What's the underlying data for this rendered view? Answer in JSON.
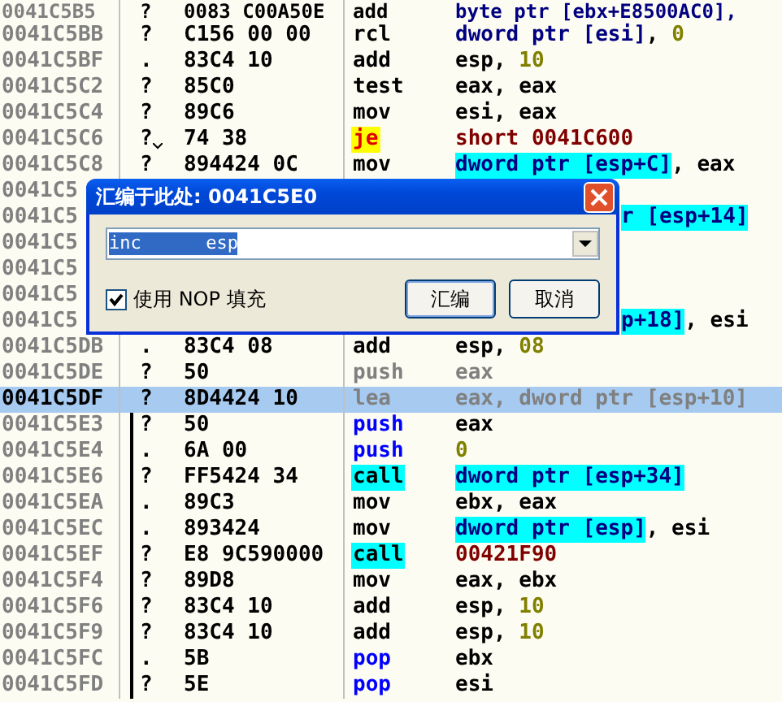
{
  "listing": [
    {
      "kind": "instruction",
      "address": "0041C5B5",
      "mark": "?",
      "hex": "0083 C00A50E",
      "mnemonic": {
        "text": "add",
        "kind": "plain"
      },
      "operand": [
        {
          "text": "byte ptr [ebx+E8500AC0],",
          "kind": "ptr"
        }
      ],
      "selected": false,
      "dimmed": false,
      "bracket": false,
      "jump_arrow": false
    },
    {
      "kind": "instruction",
      "address": "0041C5BB",
      "mark": "?",
      "hex": "C156 00 00",
      "mnemonic": {
        "text": "rcl",
        "kind": "plain"
      },
      "operand": [
        {
          "text": "dword ptr [esi]",
          "kind": "ptr"
        },
        {
          "text": ", ",
          "kind": "reg"
        },
        {
          "text": "0",
          "kind": "num"
        }
      ],
      "selected": false,
      "dimmed": false,
      "bracket": false,
      "jump_arrow": false
    },
    {
      "kind": "instruction",
      "address": "0041C5BF",
      "mark": ".",
      "hex": "83C4 10",
      "mnemonic": {
        "text": "add",
        "kind": "plain"
      },
      "operand": [
        {
          "text": "esp, ",
          "kind": "reg"
        },
        {
          "text": "10",
          "kind": "num"
        }
      ],
      "selected": false,
      "dimmed": false,
      "bracket": false,
      "jump_arrow": false
    },
    {
      "kind": "instruction",
      "address": "0041C5C2",
      "mark": "?",
      "hex": "85C0",
      "mnemonic": {
        "text": "test",
        "kind": "plain"
      },
      "operand": [
        {
          "text": "eax, eax",
          "kind": "reg"
        }
      ],
      "selected": false,
      "dimmed": false,
      "bracket": false,
      "jump_arrow": false
    },
    {
      "kind": "instruction",
      "address": "0041C5C4",
      "mark": "?",
      "hex": "89C6",
      "mnemonic": {
        "text": "mov",
        "kind": "plain"
      },
      "operand": [
        {
          "text": "esi, eax",
          "kind": "reg"
        }
      ],
      "selected": false,
      "dimmed": false,
      "bracket": false,
      "jump_arrow": false
    },
    {
      "kind": "instruction",
      "address": "0041C5C6",
      "mark": "?",
      "hex": "74 38",
      "mnemonic": {
        "text": "je",
        "kind": "jump"
      },
      "operand": [
        {
          "text": "short 0041C600",
          "kind": "addr"
        }
      ],
      "selected": false,
      "dimmed": false,
      "bracket": false,
      "jump_arrow": true
    },
    {
      "kind": "instruction",
      "address": "0041C5C8",
      "mark": "?",
      "hex": "894424 0C",
      "mnemonic": {
        "text": "mov",
        "kind": "plain"
      },
      "operand": [
        {
          "text": "dword ptr [esp+C]",
          "kind": "mem"
        },
        {
          "text": ", eax",
          "kind": "reg"
        }
      ],
      "selected": false,
      "dimmed": false,
      "bracket": false,
      "jump_arrow": false
    },
    {
      "kind": "covered",
      "address": "0041C5",
      "selected": false
    },
    {
      "kind": "covered",
      "address": "0041C5",
      "tail": [
        {
          "text": "r [esp+14]",
          "kind": "mem"
        }
      ],
      "selected": false
    },
    {
      "kind": "covered",
      "address": "0041C5",
      "selected": false
    },
    {
      "kind": "covered",
      "address": "0041C5",
      "selected": false
    },
    {
      "kind": "covered",
      "address": "0041C5",
      "selected": false
    },
    {
      "kind": "covered",
      "address": "0041C5",
      "tail": [
        {
          "text": "p+18]",
          "kind": "mem"
        },
        {
          "text": ", esi",
          "kind": "reg"
        }
      ],
      "selected": false
    },
    {
      "kind": "instruction",
      "address": "0041C5DB",
      "mark": ".",
      "hex": "83C4 08",
      "mnemonic": {
        "text": "add",
        "kind": "plain"
      },
      "operand": [
        {
          "text": "esp, ",
          "kind": "reg"
        },
        {
          "text": "08",
          "kind": "num"
        }
      ],
      "selected": false,
      "dimmed": false,
      "bracket": false,
      "jump_arrow": false
    },
    {
      "kind": "instruction",
      "address": "0041C5DE",
      "mark": "?",
      "hex": "50",
      "mnemonic": {
        "text": "push",
        "kind": "stack"
      },
      "operand": [
        {
          "text": "eax",
          "kind": "reg"
        }
      ],
      "selected": false,
      "dimmed": true,
      "bracket": false,
      "jump_arrow": false
    },
    {
      "kind": "instruction",
      "address": "0041C5DF",
      "mark": "?",
      "hex": "8D4424 10",
      "mnemonic": {
        "text": "lea",
        "kind": "plain"
      },
      "operand": [
        {
          "text": "eax, dword ptr [esp+10]",
          "kind": "reg"
        }
      ],
      "selected": true,
      "dimmed": true,
      "bracket": false,
      "jump_arrow": false
    },
    {
      "kind": "instruction",
      "address": "0041C5E3",
      "mark": "?",
      "hex": "50",
      "mnemonic": {
        "text": "push",
        "kind": "stack"
      },
      "operand": [
        {
          "text": "eax",
          "kind": "reg"
        }
      ],
      "selected": false,
      "dimmed": false,
      "bracket": true,
      "jump_arrow": false
    },
    {
      "kind": "instruction",
      "address": "0041C5E4",
      "mark": ".",
      "hex": "6A 00",
      "mnemonic": {
        "text": "push",
        "kind": "stack"
      },
      "operand": [
        {
          "text": "0",
          "kind": "num"
        }
      ],
      "selected": false,
      "dimmed": false,
      "bracket": true,
      "jump_arrow": false
    },
    {
      "kind": "instruction",
      "address": "0041C5E6",
      "mark": "?",
      "hex": "FF5424 34",
      "mnemonic": {
        "text": "call",
        "kind": "call"
      },
      "operand": [
        {
          "text": "dword ptr [esp+34]",
          "kind": "mem"
        }
      ],
      "selected": false,
      "dimmed": false,
      "bracket": true,
      "jump_arrow": false
    },
    {
      "kind": "instruction",
      "address": "0041C5EA",
      "mark": ".",
      "hex": "89C3",
      "mnemonic": {
        "text": "mov",
        "kind": "plain"
      },
      "operand": [
        {
          "text": "ebx, eax",
          "kind": "reg"
        }
      ],
      "selected": false,
      "dimmed": false,
      "bracket": true,
      "jump_arrow": false
    },
    {
      "kind": "instruction",
      "address": "0041C5EC",
      "mark": ".",
      "hex": "893424",
      "mnemonic": {
        "text": "mov",
        "kind": "plain"
      },
      "operand": [
        {
          "text": "dword ptr [esp]",
          "kind": "mem"
        },
        {
          "text": ", esi",
          "kind": "reg"
        }
      ],
      "selected": false,
      "dimmed": false,
      "bracket": true,
      "jump_arrow": false
    },
    {
      "kind": "instruction",
      "address": "0041C5EF",
      "mark": "?",
      "hex": "E8 9C590000",
      "mnemonic": {
        "text": "call",
        "kind": "call"
      },
      "operand": [
        {
          "text": "00421F90",
          "kind": "addr"
        }
      ],
      "selected": false,
      "dimmed": false,
      "bracket": true,
      "jump_arrow": false
    },
    {
      "kind": "instruction",
      "address": "0041C5F4",
      "mark": "?",
      "hex": "89D8",
      "mnemonic": {
        "text": "mov",
        "kind": "plain"
      },
      "operand": [
        {
          "text": "eax, ebx",
          "kind": "reg"
        }
      ],
      "selected": false,
      "dimmed": false,
      "bracket": true,
      "jump_arrow": false
    },
    {
      "kind": "instruction",
      "address": "0041C5F6",
      "mark": "?",
      "hex": "83C4 10",
      "mnemonic": {
        "text": "add",
        "kind": "plain"
      },
      "operand": [
        {
          "text": "esp, ",
          "kind": "reg"
        },
        {
          "text": "10",
          "kind": "num"
        }
      ],
      "selected": false,
      "dimmed": false,
      "bracket": true,
      "jump_arrow": false
    },
    {
      "kind": "instruction",
      "address": "0041C5F9",
      "mark": "?",
      "hex": "83C4 10",
      "mnemonic": {
        "text": "add",
        "kind": "plain"
      },
      "operand": [
        {
          "text": "esp, ",
          "kind": "reg"
        },
        {
          "text": "10",
          "kind": "num"
        }
      ],
      "selected": false,
      "dimmed": false,
      "bracket": true,
      "jump_arrow": false
    },
    {
      "kind": "instruction",
      "address": "0041C5FC",
      "mark": ".",
      "hex": "5B",
      "mnemonic": {
        "text": "pop",
        "kind": "stack"
      },
      "operand": [
        {
          "text": "ebx",
          "kind": "reg"
        }
      ],
      "selected": false,
      "dimmed": false,
      "bracket": true,
      "jump_arrow": false
    },
    {
      "kind": "instruction",
      "address": "0041C5FD",
      "mark": "?",
      "hex": "5E",
      "mnemonic": {
        "text": "pop",
        "kind": "stack"
      },
      "operand": [
        {
          "text": "esi",
          "kind": "reg"
        }
      ],
      "selected": false,
      "dimmed": false,
      "bracket": true,
      "jump_arrow": false
    }
  ],
  "dialog": {
    "title": "汇编于此处: 0041C5E0",
    "input": {
      "value": "inc      esp"
    },
    "checkbox": {
      "label": "使用 NOP 填充",
      "checked": true
    },
    "buttons": [
      "汇编",
      "取消"
    ]
  }
}
